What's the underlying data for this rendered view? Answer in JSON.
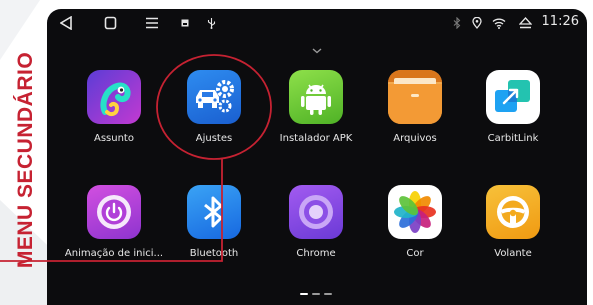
{
  "side_label": "MENU SECUNDÁRIO",
  "status": {
    "time": "11:26",
    "icons": [
      "back-icon",
      "home-icon",
      "menu-icon",
      "image-notification-icon",
      "usb-icon",
      "bluetooth-icon",
      "location-icon",
      "wifi-icon",
      "eject-icon"
    ]
  },
  "apps": [
    {
      "label": "Assunto",
      "icon": "chameleon-icon"
    },
    {
      "label": "Ajustes",
      "icon": "car-settings-icon"
    },
    {
      "label": "Instalador APK",
      "icon": "android-icon"
    },
    {
      "label": "Arquivos",
      "icon": "folder-icon"
    },
    {
      "label": "CarbitLink",
      "icon": "carbitlink-icon"
    },
    {
      "label": "Animação de inici...",
      "icon": "power-icon"
    },
    {
      "label": "Bluetooth",
      "icon": "bluetooth-icon"
    },
    {
      "label": "Chrome",
      "icon": "chrome-icon"
    },
    {
      "label": "Cor",
      "icon": "color-flower-icon"
    },
    {
      "label": "Volante",
      "icon": "steering-wheel-icon"
    }
  ],
  "colors": {
    "accent_red": "#c62232",
    "screen_bg": "#0c0c0e"
  },
  "pager": {
    "pages": 3,
    "active": 0
  }
}
